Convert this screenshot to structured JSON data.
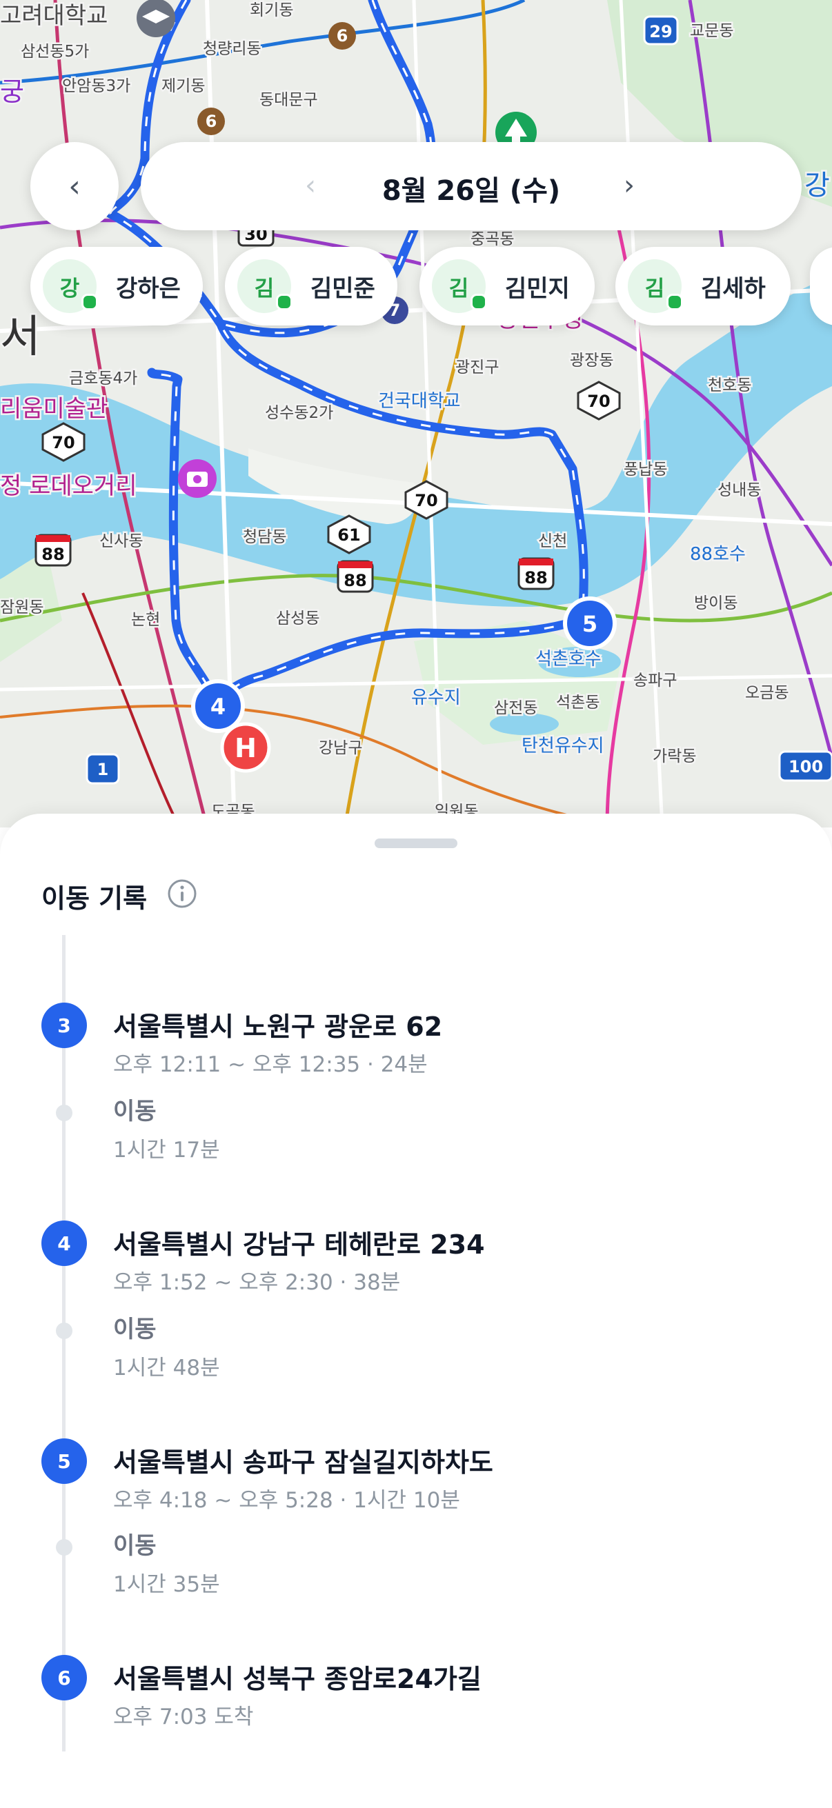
{
  "header": {
    "date": "8월 26일 (수)",
    "prev_icon": "chevron-left-icon",
    "date_prev_icon": "chevron-left-icon",
    "date_next_icon": "chevron-right-icon"
  },
  "members": [
    {
      "initial": "강",
      "name": "강하은"
    },
    {
      "initial": "김",
      "name": "김민준"
    },
    {
      "initial": "김",
      "name": "김민지"
    },
    {
      "initial": "김",
      "name": "김세하"
    }
  ],
  "map": {
    "labels": [
      "고려대학교",
      "회기동",
      "교문동",
      "삼선동5가",
      "청량리동",
      "안암동3가",
      "제기동",
      "동대문구",
      "중곡동",
      "광진구",
      "광장동",
      "천호동",
      "금호동4가",
      "성수동2가",
      "건국대학교",
      "리움미술관",
      "정 로데오거리",
      "풍납동",
      "성내동",
      "신사동",
      "청담동",
      "신천",
      "88호수",
      "잠원동",
      "논현",
      "삼성동",
      "방이동",
      "석촌호수",
      "송파구",
      "오금동",
      "유수지",
      "삼전동",
      "석촌동",
      "강남구",
      "탄천유수지",
      "가락동",
      "도곡동",
      "일원동",
      "서",
      "궁",
      "강",
      "광진구청"
    ],
    "route_markers": [
      "4",
      "5"
    ],
    "road_shields": [
      "70",
      "70",
      "70",
      "61",
      "88",
      "88",
      "88",
      "29",
      "6",
      "6",
      "30",
      "1",
      "100",
      "7"
    ],
    "hospital_icon": "hospital-icon",
    "camera_icon": "camera-icon",
    "park_icon": "tree-icon",
    "route_color": "#2563eb"
  },
  "sheet": {
    "title": "이동 기록",
    "info_icon": "info-icon",
    "timeline": [
      {
        "type": "stop",
        "index": "3",
        "address": "서울특별시 노원구 광운로 62",
        "detail": "오후 12:11 ~ 오후 12:35 · 24분"
      },
      {
        "type": "move",
        "label": "이동",
        "duration": "1시간 17분"
      },
      {
        "type": "stop",
        "index": "4",
        "address": "서울특별시 강남구 테헤란로 234",
        "detail": "오후 1:52 ~ 오후 2:30 · 38분"
      },
      {
        "type": "move",
        "label": "이동",
        "duration": "1시간 48분"
      },
      {
        "type": "stop",
        "index": "5",
        "address": "서울특별시 송파구 잠실길지하차도",
        "detail": "오후 4:18 ~ 오후 5:28 · 1시간 10분"
      },
      {
        "type": "move",
        "label": "이동",
        "duration": "1시간 35분"
      },
      {
        "type": "stop",
        "index": "6",
        "address": "서울특별시 성북구 종암로24가길",
        "detail": "오후 7:03 도착"
      }
    ]
  },
  "colors": {
    "accent": "#2563eb",
    "member_green": "#23a047",
    "river": "#8fd3ee"
  }
}
